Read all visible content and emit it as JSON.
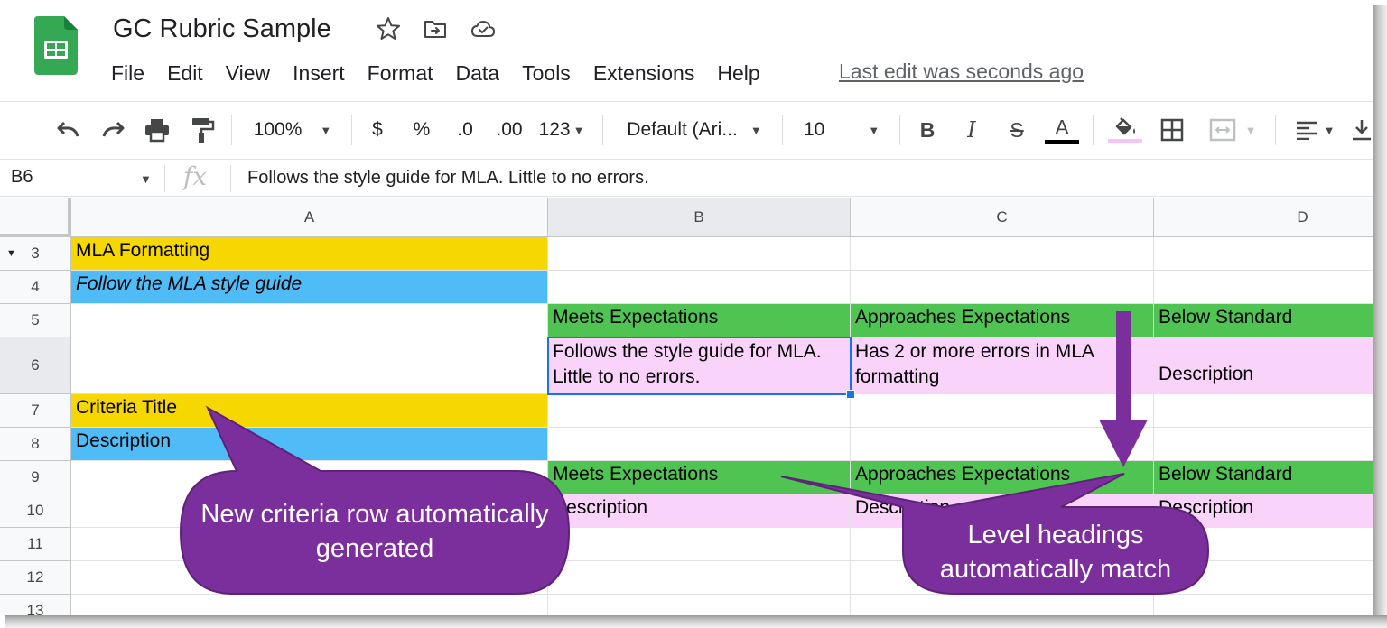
{
  "app": {
    "title": "GC Rubric Sample",
    "last_edit": "Last edit was seconds ago"
  },
  "menu": [
    "File",
    "Edit",
    "View",
    "Insert",
    "Format",
    "Data",
    "Tools",
    "Extensions",
    "Help"
  ],
  "toolbar": {
    "zoom": "100%",
    "currency": "$",
    "percent": "%",
    "decrease_decimal": ".0",
    "increase_decimal": ".00",
    "more_formats": "123",
    "font": "Default (Ari...",
    "font_size": "10",
    "bold": "B",
    "italic": "I",
    "strike": "S",
    "text_color": "A"
  },
  "formula_bar": {
    "name_box": "B6",
    "fx": "fx",
    "value": "Follows the style guide for MLA. Little to no errors."
  },
  "columns": [
    "A",
    "B",
    "C",
    "D"
  ],
  "rows": [
    "3",
    "4",
    "5",
    "6",
    "7",
    "8",
    "9",
    "10",
    "11",
    "12",
    "13"
  ],
  "cells": {
    "A3": "MLA Formatting",
    "A4": "Follow the MLA style guide",
    "B5": "Meets Expectations",
    "C5": "Approaches Expectations",
    "D5": "Below Standard",
    "B6": "Follows the style guide for MLA. Little to no errors.",
    "C6": "Has 2 or more errors in MLA formatting",
    "D6": "Description",
    "A7": "Criteria Title",
    "A8": "Description",
    "B9": "Meets Expectations",
    "C9": "Approaches Expectations",
    "D9": "Below Standard",
    "B10": "Description",
    "C10": "Description",
    "D10": "Description"
  },
  "colors": {
    "yellow": "#f7d700",
    "blue": "#4fbcf7",
    "green": "#4fc453",
    "pink": "#f9d3fa",
    "callout": "#7b2f9d",
    "selection": "#1a73e8"
  },
  "callouts": {
    "left": "New criteria row automatically generated",
    "right": "Level headings automatically match"
  }
}
